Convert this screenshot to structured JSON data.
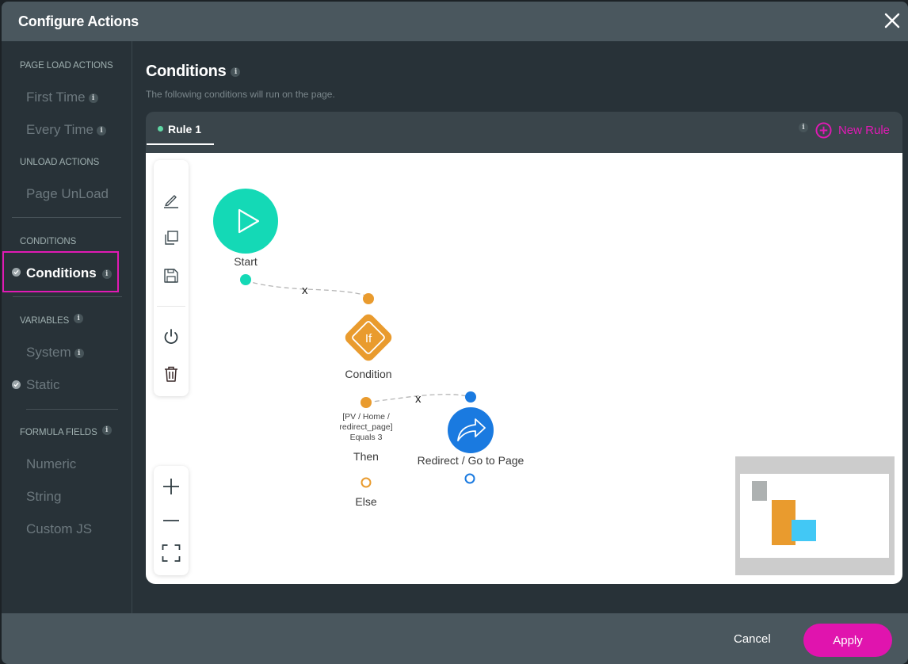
{
  "window": {
    "title": "Configure Actions",
    "close_icon": "close-icon"
  },
  "sidebar": {
    "sections": [
      {
        "label": "PAGE LOAD ACTIONS",
        "items": [
          {
            "label": "First Time",
            "info": true
          },
          {
            "label": "Every Time",
            "info": true
          }
        ]
      },
      {
        "label": "UNLOAD ACTIONS",
        "items": [
          {
            "label": "Page UnLoad"
          }
        ]
      },
      {
        "label": "CONDITIONS",
        "items": [
          {
            "label": "Conditions",
            "info": true,
            "checked": true,
            "active": true
          }
        ]
      },
      {
        "label": "VARIABLES",
        "info": true,
        "items": [
          {
            "label": "System",
            "info": true
          },
          {
            "label": "Static",
            "checked": true
          }
        ]
      },
      {
        "label": "FORMULA FIELDS",
        "info": true,
        "items": [
          {
            "label": "Numeric"
          },
          {
            "label": "String"
          },
          {
            "label": "Custom JS"
          }
        ]
      }
    ],
    "info_glyph": "i"
  },
  "main": {
    "title": "Conditions",
    "subtitle": "The following conditions will run on the page.",
    "tabs": [
      {
        "label": "Rule 1",
        "active": true,
        "status_color": "#5fd6a4"
      }
    ],
    "new_rule_label": "New Rule"
  },
  "toolbar": {
    "tools": [
      "edit-icon",
      "duplicate-icon",
      "save-icon",
      "power-icon",
      "delete-icon"
    ],
    "zoom_tools": [
      "zoom-in-icon",
      "zoom-out-icon",
      "fit-screen-icon"
    ]
  },
  "flow": {
    "nodes": [
      {
        "id": "start",
        "label": "Start",
        "color": "#14d9b6",
        "icon": "play-icon"
      },
      {
        "id": "condition",
        "label": "Condition",
        "color": "#e99b2e",
        "icon": "if-icon",
        "icon_text": "If"
      },
      {
        "id": "redirect",
        "label": "Redirect / Go to Page",
        "color": "#1a7ae0",
        "icon": "redirect-icon"
      }
    ],
    "condition_expression": [
      "[PV / Home /",
      "redirect_page]",
      "Equals 3"
    ],
    "branch_then": "Then",
    "branch_else": "Else",
    "edge_delete_glyph": "x"
  },
  "footer": {
    "cancel_label": "Cancel",
    "apply_label": "Apply"
  },
  "colors": {
    "accent": "#e014ae",
    "header": "#4a575e",
    "sidebar": "#283238"
  }
}
